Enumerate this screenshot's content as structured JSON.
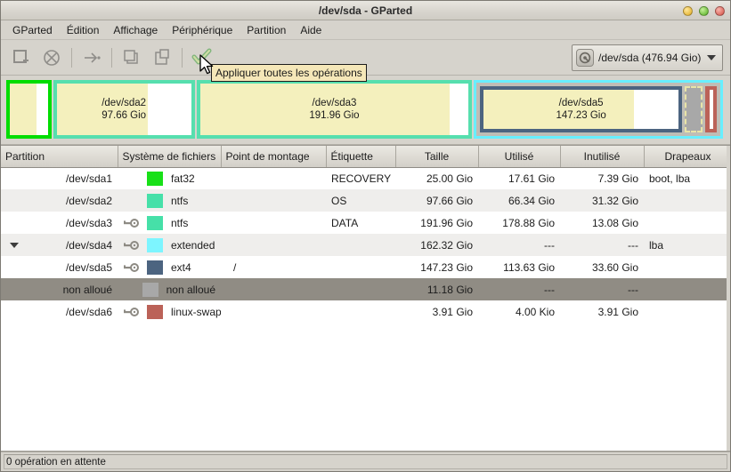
{
  "window": {
    "title": "/dev/sda - GParted",
    "buttons": [
      {
        "name": "minimize",
        "color": "#e8b93c"
      },
      {
        "name": "maximize",
        "color": "#6fbe3e"
      },
      {
        "name": "close",
        "color": "#dd675c"
      }
    ]
  },
  "menubar": {
    "items": [
      {
        "label": "GParted"
      },
      {
        "label": "Édition"
      },
      {
        "label": "Affichage"
      },
      {
        "label": "Périphérique"
      },
      {
        "label": "Partition"
      },
      {
        "label": "Aide"
      }
    ]
  },
  "toolbar": {
    "buttons": [
      {
        "name": "new-partition-icon",
        "label": "Nouveau"
      },
      {
        "name": "delete-partition-icon",
        "label": "Supprimer"
      },
      {
        "name": "resize-move-icon",
        "label": "Redimensionner/Déplacer"
      },
      {
        "name": "copy-icon",
        "label": "Copier"
      },
      {
        "name": "paste-icon",
        "label": "Coller"
      },
      {
        "name": "apply-operations-icon",
        "label": "Appliquer toutes les opérations"
      }
    ],
    "tooltip": "Appliquer toutes les opérations",
    "device_selector": {
      "icon": "hard-disk-icon",
      "label": "/dev/sda   (476.94 Gio)"
    }
  },
  "diskview": {
    "blocks": [
      {
        "name": "/dev/sda1",
        "size_label": "",
        "show_label": false,
        "border_color": "#00dd00",
        "fill_color": "#f4f0bd",
        "used_percent": 70,
        "flex": 45
      },
      {
        "name": "/dev/sda2",
        "size_label": "97.66 Gio",
        "show_label": true,
        "border_color": "#56dfae",
        "fill_color": "#f4f0bd",
        "used_percent": 68,
        "flex": 159
      },
      {
        "name": "/dev/sda3",
        "size_label": "191.96 Gio",
        "show_label": true,
        "border_color": "#56dfae",
        "fill_color": "#f4f0bd",
        "used_percent": 93,
        "flex": 318
      }
    ],
    "extended": {
      "name": "/dev/sda4",
      "border_color": "#68efff",
      "children": [
        {
          "name": "/dev/sda5",
          "size_label": "147.23 Gio",
          "show_label": true,
          "border_color": "#4c6480",
          "fill_color": "#f4f0bd",
          "used_percent": 77,
          "flex": 240
        },
        {
          "name": "non alloué",
          "type": "unallocated",
          "flex": 18
        },
        {
          "name": "linux-swap",
          "type": "swap",
          "border_color": "#bb6258",
          "flex": 14
        }
      ]
    }
  },
  "table": {
    "columns": [
      {
        "label": "Partition",
        "align": "left"
      },
      {
        "label": "Système de fichiers",
        "align": "left"
      },
      {
        "label": "Point de montage",
        "align": "left"
      },
      {
        "label": "Étiquette",
        "align": "left"
      },
      {
        "label": "Taille",
        "align": "center"
      },
      {
        "label": "Utilisé",
        "align": "center"
      },
      {
        "label": "Inutilisé",
        "align": "center"
      },
      {
        "label": "Drapeaux",
        "align": "center"
      }
    ],
    "rows": [
      {
        "partition": "/dev/sda1",
        "mounted": false,
        "expander": false,
        "indent": 0,
        "swatch": "#18e018",
        "filesystem": "fat32",
        "mountpoint": "",
        "label": "RECOVERY",
        "size": "25.00 Gio",
        "used": "17.61 Gio",
        "unused": "7.39 Gio",
        "flags": "boot, lba",
        "style": "normal"
      },
      {
        "partition": "/dev/sda2",
        "mounted": false,
        "expander": false,
        "indent": 0,
        "swatch": "#46e0a8",
        "filesystem": "ntfs",
        "mountpoint": "",
        "label": "OS",
        "size": "97.66 Gio",
        "used": "66.34 Gio",
        "unused": "31.32 Gio",
        "flags": "",
        "style": "alt"
      },
      {
        "partition": "/dev/sda3",
        "mounted": true,
        "expander": false,
        "indent": 0,
        "swatch": "#46e0a8",
        "filesystem": "ntfs",
        "mountpoint": "",
        "label": "DATA",
        "size": "191.96 Gio",
        "used": "178.88 Gio",
        "unused": "13.08 Gio",
        "flags": "",
        "style": "normal"
      },
      {
        "partition": "/dev/sda4",
        "mounted": true,
        "expander": true,
        "indent": 0,
        "swatch": "#7df5ff",
        "filesystem": "extended",
        "mountpoint": "",
        "label": "",
        "size": "162.32 Gio",
        "used": "---",
        "unused": "---",
        "flags": "lba",
        "style": "alt"
      },
      {
        "partition": "/dev/sda5",
        "mounted": true,
        "expander": false,
        "indent": 1,
        "swatch": "#4c6480",
        "filesystem": "ext4",
        "mountpoint": "/",
        "label": "",
        "size": "147.23 Gio",
        "used": "113.63 Gio",
        "unused": "33.60 Gio",
        "flags": "",
        "style": "normal"
      },
      {
        "partition": "non alloué",
        "mounted": false,
        "expander": false,
        "indent": 1,
        "swatch": "#a8a8a8",
        "filesystem": "non alloué",
        "mountpoint": "",
        "label": "",
        "size": "11.18 Gio",
        "used": "---",
        "unused": "---",
        "flags": "",
        "style": "selected"
      },
      {
        "partition": "/dev/sda6",
        "mounted": true,
        "expander": false,
        "indent": 1,
        "swatch": "#bb6258",
        "filesystem": "linux-swap",
        "mountpoint": "",
        "label": "",
        "size": "3.91 Gio",
        "used": "4.00 Kio",
        "unused": "3.91 Gio",
        "flags": "",
        "style": "normal"
      }
    ]
  },
  "statusbar": {
    "text": "0 opération en attente"
  }
}
